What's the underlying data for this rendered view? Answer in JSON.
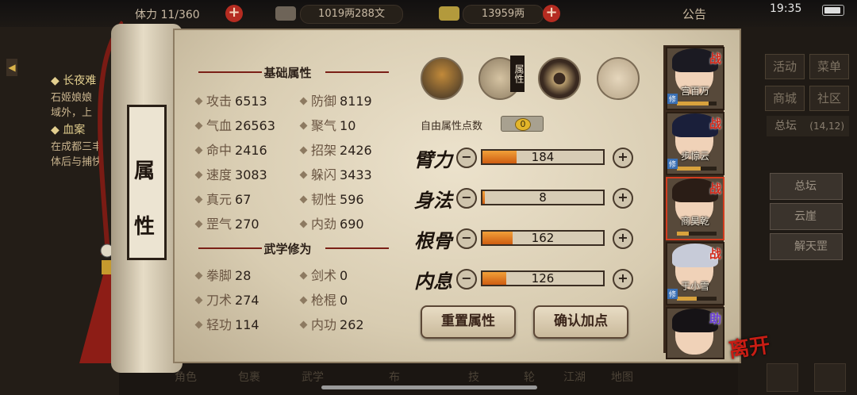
{
  "status_bar": {
    "stamina_prefix": "体力",
    "stamina": "11/360",
    "money": "1019两288文",
    "gold": "13959两",
    "notice": "公告",
    "time": "19:35"
  },
  "left_quests": {
    "quest1_title": "长夜难",
    "quest1_line1": "石姬娘娘",
    "quest1_line2": "域外，上",
    "quest2_title": "血案",
    "quest2_line1": "在成都三丰",
    "quest2_line2": "体后与捕快"
  },
  "right_menu": {
    "activity": "活动",
    "menu": "菜单",
    "shop": "商城",
    "community": "社区",
    "location": "总坛",
    "coords": "(14,12)",
    "loc_buttons": [
      "总坛",
      "云崖",
      "解天罡"
    ]
  },
  "bottom_tabs": [
    "角色",
    "包裹",
    "武学",
    "布",
    "技",
    "轮",
    "江湖",
    "地图"
  ],
  "scroll_title": [
    "属",
    "性"
  ],
  "basic_attributes": {
    "header": "基础属性",
    "rows": [
      {
        "l_label": "攻击",
        "l_val": "6513",
        "r_label": "防御",
        "r_val": "8119"
      },
      {
        "l_label": "气血",
        "l_val": "26563",
        "r_label": "聚气",
        "r_val": "10"
      },
      {
        "l_label": "命中",
        "l_val": "2416",
        "r_label": "招架",
        "r_val": "2426"
      },
      {
        "l_label": "速度",
        "l_val": "3083",
        "r_label": "躲闪",
        "r_val": "3433"
      },
      {
        "l_label": "真元",
        "l_val": "67",
        "r_label": "韧性",
        "r_val": "596"
      },
      {
        "l_label": "罡气",
        "l_val": "270",
        "r_label": "内劲",
        "r_val": "690"
      }
    ]
  },
  "martial_arts": {
    "header": "武学修为",
    "rows": [
      {
        "l_label": "拳脚",
        "l_val": "28",
        "r_label": "剑术",
        "r_val": "0"
      },
      {
        "l_label": "刀术",
        "l_val": "274",
        "r_label": "枪棍",
        "r_val": "0"
      },
      {
        "l_label": "轻功",
        "l_val": "114",
        "r_label": "内功",
        "r_val": "262"
      }
    ]
  },
  "top_icons": {
    "attributes_tag": "属性"
  },
  "free_points": {
    "label": "自由属性点数",
    "value": "0"
  },
  "stats": [
    {
      "name": "臂力",
      "value": "184",
      "fill": 0.28
    },
    {
      "name": "身法",
      "value": "8",
      "fill": 0.02
    },
    {
      "name": "根骨",
      "value": "162",
      "fill": 0.25
    },
    {
      "name": "内息",
      "value": "126",
      "fill": 0.2
    }
  ],
  "buttons": {
    "reset": "重置属性",
    "confirm": "确认加点",
    "leave": "离开"
  },
  "heroes": [
    {
      "name": "宫百万",
      "tag": "战",
      "xp": 0.8,
      "lv": "修"
    },
    {
      "name": "步惊云",
      "tag": "战",
      "xp": 0.6,
      "lv": "修"
    },
    {
      "name": "商昊乾",
      "tag": "战",
      "xp": 0.3,
      "lv": ""
    },
    {
      "name": "于小雪",
      "tag": "战",
      "xp": 0.5,
      "lv": "修"
    },
    {
      "name": "",
      "tag": "助",
      "xp": 0,
      "lv": ""
    }
  ],
  "colors": {
    "accent_red": "#b52c21",
    "bar_fill": "#e27a22",
    "parchment": "#e2d7bf"
  }
}
